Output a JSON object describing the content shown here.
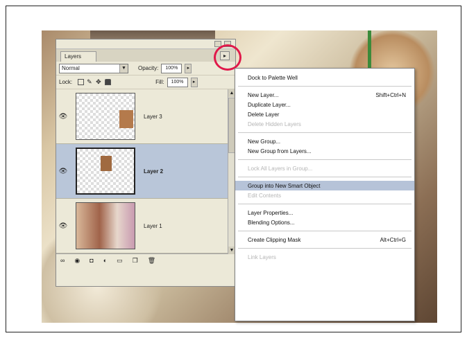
{
  "palette": {
    "tab_label": "Layers",
    "menu_button_glyph": "▸",
    "blend_mode": "Normal",
    "opacity_label": "Opacity:",
    "opacity_value": "100%",
    "lock_label": "Lock:",
    "fill_label": "Fill:",
    "fill_value": "100%",
    "layers": [
      {
        "name": "Layer 3",
        "visible": true,
        "selected": false
      },
      {
        "name": "Layer 2",
        "visible": true,
        "selected": true
      },
      {
        "name": "Layer 1",
        "visible": true,
        "selected": false
      }
    ],
    "bottom_icons": [
      "link-icon",
      "fx-icon",
      "mask-icon",
      "adjustment-icon",
      "group-icon",
      "new-layer-icon",
      "trash-icon"
    ]
  },
  "menu": {
    "items": [
      {
        "label": "Dock to Palette Well",
        "shortcut": "",
        "disabled": false
      },
      {
        "label": "New Layer...",
        "shortcut": "Shift+Ctrl+N",
        "disabled": false
      },
      {
        "label": "Duplicate Layer...",
        "shortcut": "",
        "disabled": false
      },
      {
        "label": "Delete Layer",
        "shortcut": "",
        "disabled": false
      },
      {
        "label": "Delete Hidden Layers",
        "shortcut": "",
        "disabled": true
      },
      {
        "label": "New Group...",
        "shortcut": "",
        "disabled": false
      },
      {
        "label": "New Group from Layers...",
        "shortcut": "",
        "disabled": false
      },
      {
        "label": "Lock All Layers in Group...",
        "shortcut": "",
        "disabled": true
      },
      {
        "label": "Group into New Smart Object",
        "shortcut": "",
        "disabled": false,
        "highlighted": true
      },
      {
        "label": "Edit Contents",
        "shortcut": "",
        "disabled": true
      },
      {
        "label": "Layer Properties...",
        "shortcut": "",
        "disabled": false
      },
      {
        "label": "Blending Options...",
        "shortcut": "",
        "disabled": false
      },
      {
        "label": "Create Clipping Mask",
        "shortcut": "Alt+Ctrl+G",
        "disabled": false
      },
      {
        "label": "Link Layers",
        "shortcut": "",
        "disabled": true
      }
    ]
  },
  "colors": {
    "highlight": "#b6c3d8",
    "selected_layer": "#b9c6d9",
    "callout": "#e0194a"
  }
}
